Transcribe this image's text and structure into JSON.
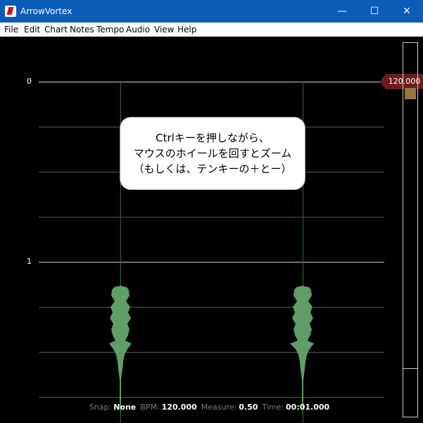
{
  "window": {
    "title": "ArrowVortex",
    "controls": [
      "—",
      "☐",
      "✕"
    ]
  },
  "menu": [
    "File",
    "Edit",
    "Chart",
    "Notes",
    "Tempo",
    "Audio",
    "View",
    "Help"
  ],
  "measures": [
    "0",
    "1"
  ],
  "bpm_marker": "120.000",
  "tooltip": {
    "lines": [
      "Ctrlキーを押しながら、",
      "マウスのホイールを回すとズーム",
      "（もしくは、テンキーの＋とー）"
    ]
  },
  "status": {
    "snap_label": "Snap:",
    "snap_value": "None",
    "bpm_label": "BPM:",
    "bpm_value": "120.000",
    "measure_label": "Measure:",
    "measure_value": "0.50",
    "time_label": "Time:",
    "time_value": "00:01.000"
  },
  "colors": {
    "titlebar": "#0b5cb8",
    "waveform": "#5f9e66",
    "bpm_marker": "#6b1c1c",
    "scroll_thumb": "#9a7548"
  }
}
